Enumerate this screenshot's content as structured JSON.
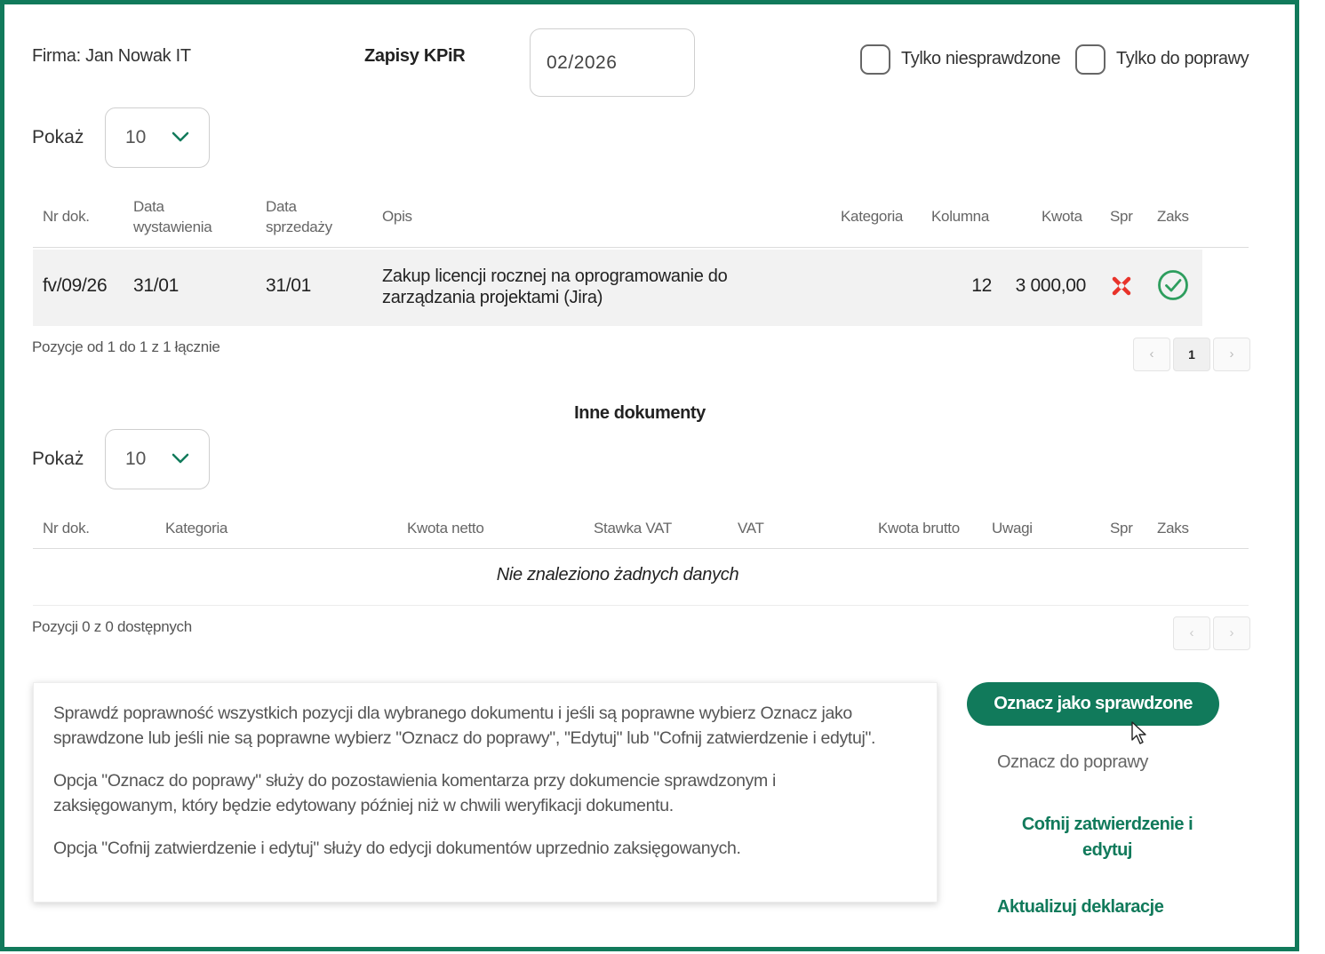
{
  "header": {
    "firm": "Firma: Jan Nowak IT",
    "title": "Zapisy KPiR",
    "period": "02/2026",
    "filter_unchecked": "Tylko niesprawdzone",
    "filter_correction": "Tylko do poprawy"
  },
  "kpir": {
    "show_label": "Pokaż",
    "page_size": "10",
    "columns": {
      "nr": "Nr dok.",
      "issue_date_1": "Data",
      "issue_date_2": "wystawienia",
      "sale_date_1": "Data",
      "sale_date_2": "sprzedaży",
      "desc": "Opis",
      "category": "Kategoria",
      "column": "Kolumna",
      "amount": "Kwota",
      "checked": "Spr",
      "booked": "Zaks"
    },
    "rows": [
      {
        "nr": "fv/09/26",
        "issue_date": "31/01",
        "sale_date": "31/01",
        "desc_line1": "Zakup licencji rocznej na oprogramowanie do",
        "desc_line2": "zarządzania projektami (Jira)",
        "category": "",
        "column": "12",
        "amount": "3 000,00",
        "checked_icon": "cross-icon",
        "booked_icon": "check-circle-icon"
      }
    ],
    "footer_info": "Pozycje od 1 do 1 z 1 łącznie",
    "current_page": "1"
  },
  "other": {
    "title": "Inne dokumenty",
    "show_label": "Pokaż",
    "page_size": "10",
    "columns": {
      "nr": "Nr dok.",
      "category": "Kategoria",
      "net": "Kwota netto",
      "vat_rate": "Stawka VAT",
      "vat": "VAT",
      "gross": "Kwota brutto",
      "notes": "Uwagi",
      "checked": "Spr",
      "booked": "Zaks"
    },
    "empty_text": "Nie znaleziono żadnych danych",
    "footer_info": "Pozycji 0 z 0 dostępnych"
  },
  "note": {
    "p1_line1": "Sprawdź poprawność wszystkich pozycji dla wybranego dokumentu i jeśli są poprawne wybierz Oznacz jako",
    "p1_line2": "sprawdzone lub jeśli nie są poprawne wybierz \"Oznacz do poprawy\", \"Edytuj\" lub \"Cofnij zatwierdzenie i edytuj\".",
    "p2_line1": "Opcja \"Oznacz do poprawy\" służy do pozostawienia komentarza przy dokumencie sprawdzonym i",
    "p2_line2": "zaksięgowanym, który będzie edytowany później niż w chwili weryfikacji dokumentu.",
    "p3": "Opcja \"Cofnij zatwierdzenie i edytuj\" służy do edycji dokumentów uprzednio zaksięgowanych."
  },
  "actions": {
    "mark_checked": "Oznacz jako sprawdzone",
    "mark_correction": "Oznacz do poprawy",
    "undo_line1": "Cofnij zatwierdzenie i",
    "undo_line2": "edytuj",
    "update_declarations": "Aktualizuj deklaracje"
  },
  "colors": {
    "accent": "#117a5b",
    "error": "#e8332a",
    "success": "#2e9e5e"
  }
}
